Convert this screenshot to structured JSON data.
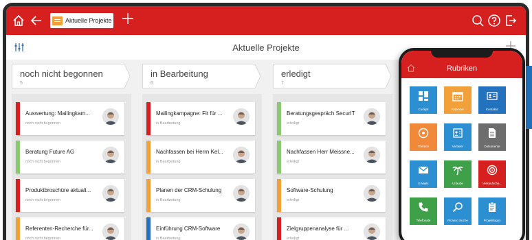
{
  "header": {
    "tab_label": "Aktuelle Projekte",
    "home_icon": "home-icon",
    "back_icon": "arrow-left-icon",
    "add_tab_icon": "plus-icon",
    "search_icon": "search-icon",
    "help_icon": "help-icon",
    "exit_icon": "logout-icon"
  },
  "toolbar": {
    "title": "Aktuelle Projekte",
    "filter_icon": "filter-icon",
    "add_icon": "plus-icon"
  },
  "colors": {
    "brand_red": "#d5201f",
    "status_red": "#d5201f",
    "status_green": "#8cc871",
    "status_orange": "#f2a03a",
    "status_blue": "#2272bd"
  },
  "columns": [
    {
      "title": "noch nicht begonnen",
      "count": "5",
      "cards": [
        {
          "title": "Auswertung: Mailingkam...",
          "status": "noch nicht begonnen",
          "color": "#d5201f"
        },
        {
          "title": "Beratung Future AG",
          "status": "noch nicht begonnen",
          "color": "#8cc871"
        },
        {
          "title": "Produktbroschüre aktuali...",
          "status": "noch nicht begonnen",
          "color": "#d5201f"
        },
        {
          "title": "Referenten-Recherche für...",
          "status": "noch nicht begonnen",
          "color": "#f2a03a"
        }
      ]
    },
    {
      "title": "in Bearbeitung",
      "count": "6",
      "cards": [
        {
          "title": "Mailingkampagne: Fit für ...",
          "status": "in Bearbeitung",
          "color": "#d5201f"
        },
        {
          "title": "Nachfassen bei Herrn Kel...",
          "status": "in Bearbeitung",
          "color": "#f2a03a"
        },
        {
          "title": "Planen der CRM-Schulung",
          "status": "in Bearbeitung",
          "color": "#f2a03a"
        },
        {
          "title": "Einführung CRM-Software",
          "status": "in Bearbeitung",
          "color": "#2272bd"
        }
      ]
    },
    {
      "title": "erledigt",
      "count": "7",
      "cards": [
        {
          "title": "Beratungsgespräch SecurIT",
          "status": "erledigt",
          "color": "#8cc871"
        },
        {
          "title": "Nachfassen Herr Meissne...",
          "status": "erledigt",
          "color": "#8cc871"
        },
        {
          "title": "Software-Schulung",
          "status": "erledigt",
          "color": "#f2a03a"
        },
        {
          "title": "Zielgruppenanalyse für ...",
          "status": "erledigt",
          "color": "#d5201f"
        }
      ]
    }
  ],
  "phone": {
    "title": "Rubriken",
    "home_icon": "home-icon",
    "tiles": [
      {
        "label": "Cockpit",
        "icon": "dashboard-icon",
        "color": "#2b8fd1"
      },
      {
        "label": "Kalender",
        "icon": "calendar-icon",
        "color": "#f2a03a"
      },
      {
        "label": "Kontakte",
        "icon": "contact-card-icon",
        "color": "#2272bd"
      },
      {
        "label": "Themen",
        "icon": "disc-icon",
        "color": "#f08a3a"
      },
      {
        "label": "Verteiler",
        "icon": "distribution-icon",
        "color": "#2b8fd1"
      },
      {
        "label": "Dokumente",
        "icon": "document-icon",
        "color": "#6d6d6d"
      },
      {
        "label": "E-Mails",
        "icon": "mail-icon",
        "color": "#2b8fd1"
      },
      {
        "label": "Urlaube",
        "icon": "palm-tree-icon",
        "color": "#3ea14a"
      },
      {
        "label": "Verkaufscha...",
        "icon": "target-icon",
        "color": "#d5201f"
      },
      {
        "label": "Telefonate",
        "icon": "phone-icon",
        "color": "#3ea14a"
      },
      {
        "label": "Picasso Suche",
        "icon": "search-icon",
        "color": "#2b8fd1"
      },
      {
        "label": "Projektlogos",
        "icon": "clipboard-icon",
        "color": "#2b8fd1"
      }
    ]
  }
}
